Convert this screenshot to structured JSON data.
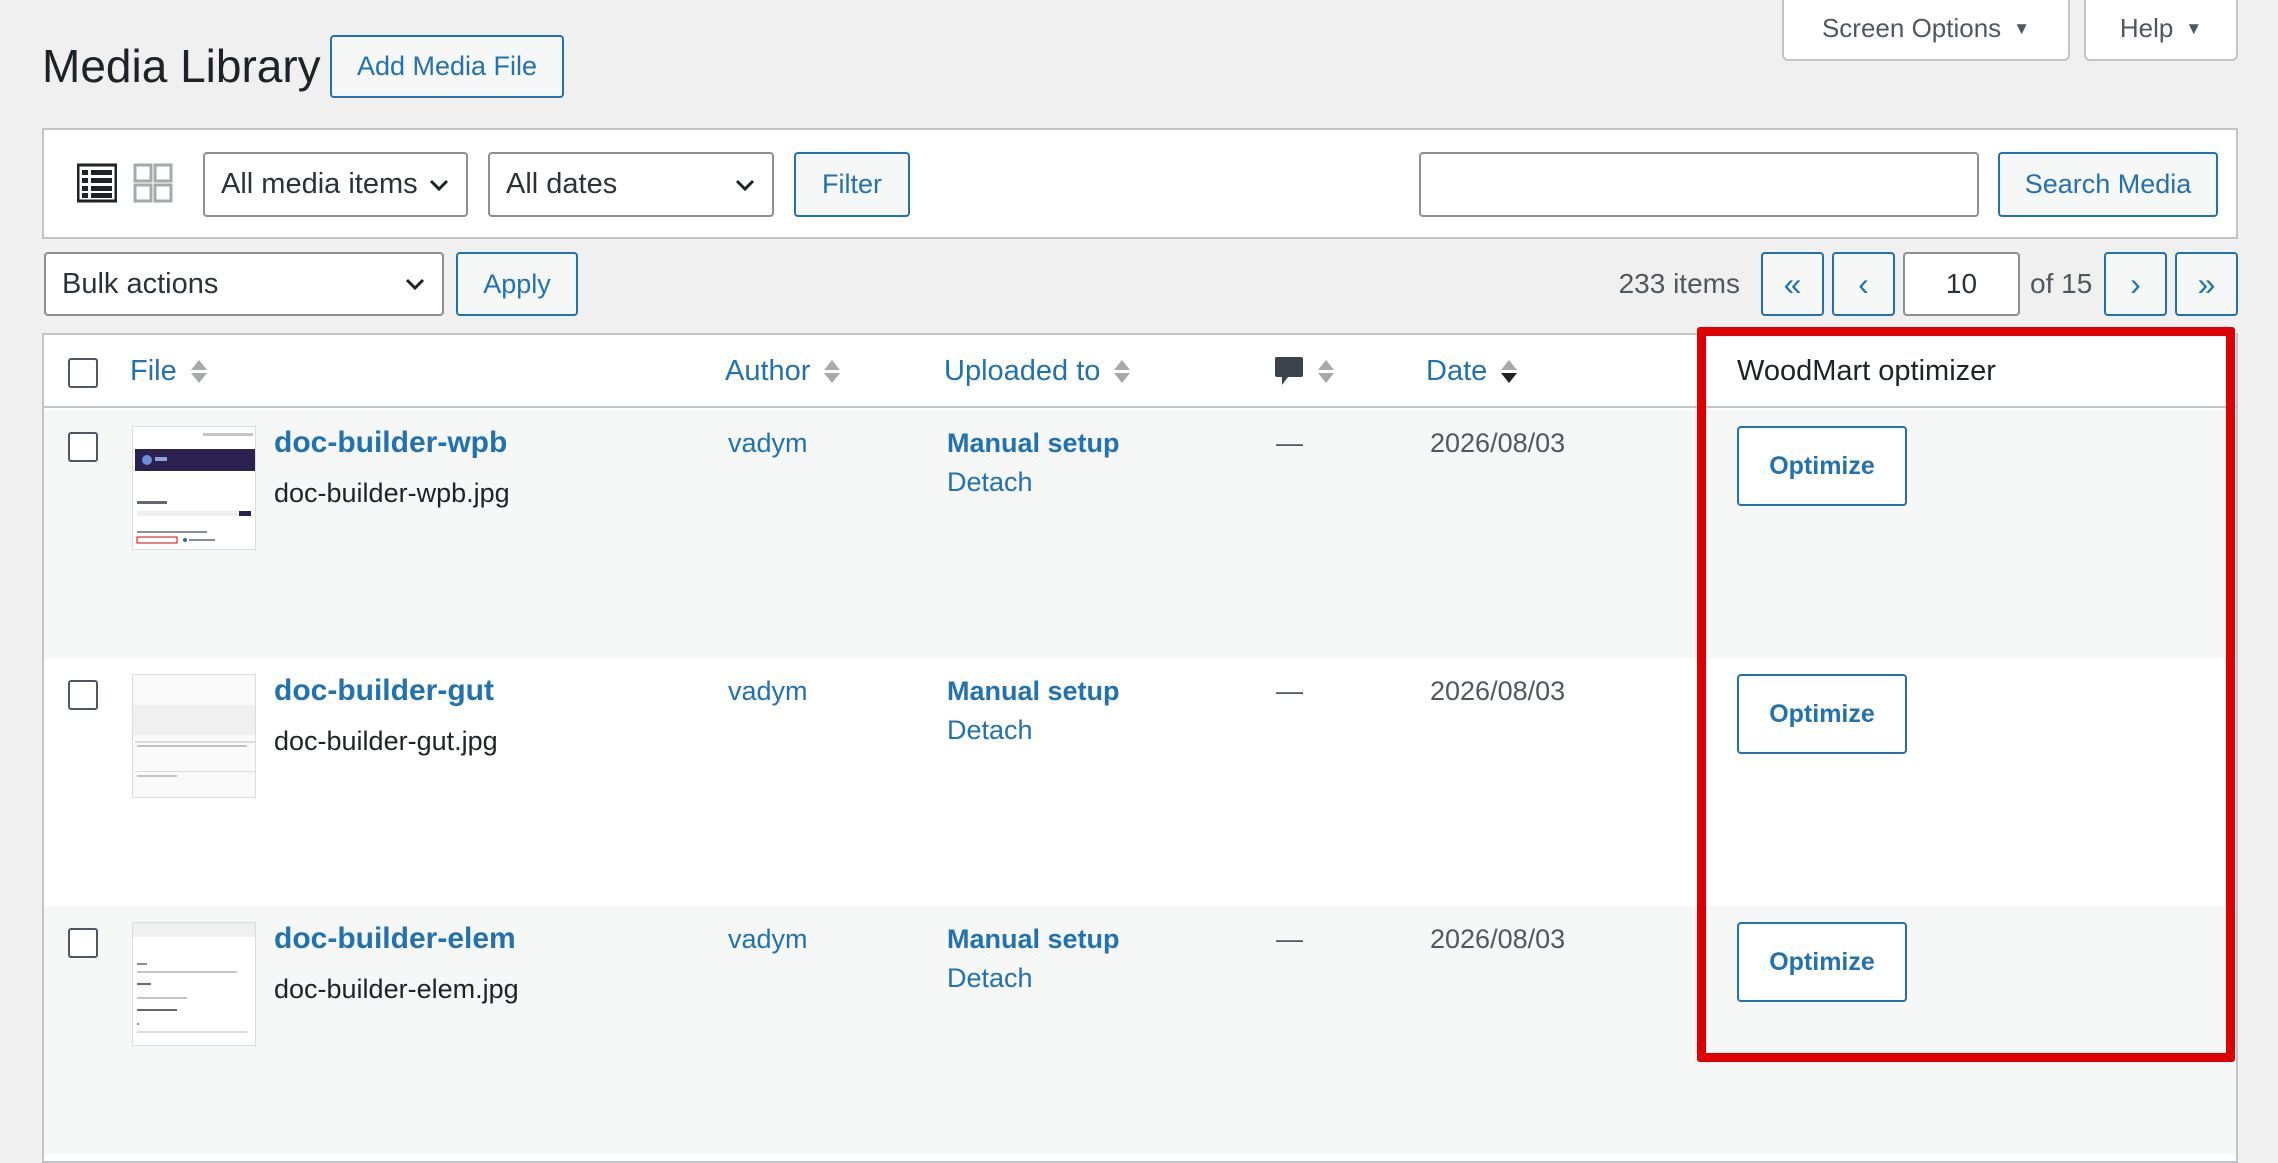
{
  "header": {
    "title": "Media Library",
    "add_button": "Add Media File",
    "screen_options": "Screen Options",
    "help": "Help"
  },
  "filters": {
    "type_select": "All media items",
    "date_select": "All dates",
    "filter_button": "Filter",
    "search_value": "",
    "search_button": "Search Media"
  },
  "bulk": {
    "select": "Bulk actions",
    "apply": "Apply"
  },
  "pagination": {
    "count": "233 items",
    "first": "«",
    "prev": "‹",
    "current_page": "10",
    "of_total": "of 15",
    "next": "›",
    "last": "»"
  },
  "columns": {
    "file": "File",
    "author": "Author",
    "uploaded_to": "Uploaded to",
    "date": "Date",
    "woodmart": "WoodMart optimizer"
  },
  "rows": [
    {
      "title": "doc-builder-wpb",
      "filename": "doc-builder-wpb.jpg",
      "author": "vadym",
      "uploaded_to": "Manual setup",
      "detach": "Detach",
      "comments": "—",
      "date": "2026/08/03",
      "action": "Optimize"
    },
    {
      "title": "doc-builder-gut",
      "filename": "doc-builder-gut.jpg",
      "author": "vadym",
      "uploaded_to": "Manual setup",
      "detach": "Detach",
      "comments": "—",
      "date": "2026/08/03",
      "action": "Optimize"
    },
    {
      "title": "doc-builder-elem",
      "filename": "doc-builder-elem.jpg",
      "author": "vadym",
      "uploaded_to": "Manual setup",
      "detach": "Detach",
      "comments": "—",
      "date": "2026/08/03",
      "action": "Optimize"
    }
  ],
  "colors": {
    "link": "#2271b1",
    "highlight": "#e00000",
    "background": "#f0f0f1"
  }
}
